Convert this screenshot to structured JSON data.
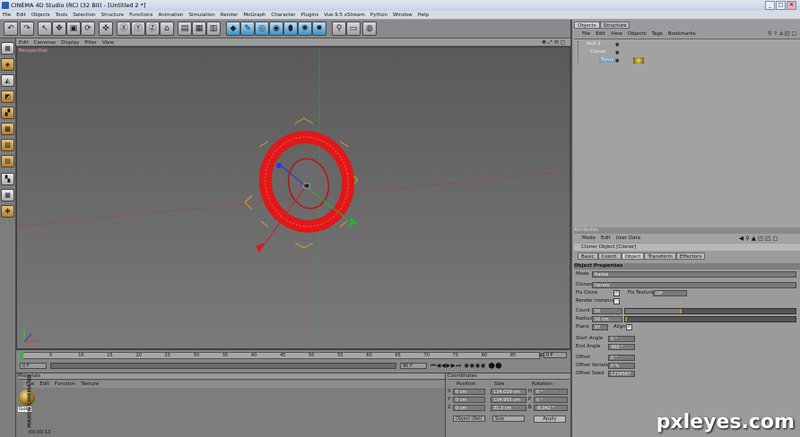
{
  "window": {
    "title": "CINEMA 4D Studio (RC) (32 Bit) - [Untitled 2 *]",
    "min": "_",
    "max": "□",
    "close": "✕"
  },
  "menubar": [
    "File",
    "Edit",
    "Objects",
    "Tools",
    "Selection",
    "Structure",
    "Functions",
    "Animation",
    "Simulation",
    "Render",
    "MoGraph",
    "Character",
    "Plugins",
    "Vue 9.5 xStream",
    "Python",
    "Window",
    "Help"
  ],
  "viewport": {
    "menu": [
      "Edit",
      "Cameras",
      "Display",
      "Filter",
      "View"
    ],
    "label": "Perspective"
  },
  "timeline": {
    "ticks": [
      "0",
      "5",
      "10",
      "15",
      "20",
      "25",
      "30",
      "35",
      "40",
      "45",
      "50",
      "55",
      "60",
      "65",
      "70",
      "75",
      "80",
      "85",
      "90"
    ],
    "start_field": "0 F",
    "end_field": "90 F",
    "current_frame": "0 F",
    "end_frame_field": "90 F"
  },
  "materials": {
    "panel_title": "Materials",
    "menu": [
      "File",
      "Edit",
      "Function",
      "Texture"
    ],
    "material_name": "Gold",
    "status_time": "00:00:13",
    "brand": "MAXON CINEMA 4D"
  },
  "coordinates": {
    "panel_title": "Coordinates",
    "headers": [
      "Position",
      "Size",
      "Rotation"
    ],
    "rows": [
      {
        "axis": "X",
        "pos": "0 cm",
        "size": "134.029 cm",
        "rot_label": "H",
        "rot": "0 °"
      },
      {
        "axis": "Y",
        "pos": "0 cm",
        "size": "134.955 cm",
        "rot_label": "P",
        "rot": "0 °"
      },
      {
        "axis": "Z",
        "pos": "0 cm",
        "size": "31.3 cm",
        "rot_label": "B",
        "rot": "-8.042 °"
      }
    ],
    "mode_select": "Object (Rel)",
    "size_select": "Size",
    "apply": "Apply"
  },
  "objects": {
    "tabs": [
      "Objects",
      "Structure"
    ],
    "menu": [
      "File",
      "Edit",
      "View",
      "Objects",
      "Tags",
      "Bookmarks"
    ],
    "items": [
      {
        "name": "Null.1"
      },
      {
        "name": "Cloner"
      },
      {
        "name": "Torus"
      }
    ]
  },
  "attributes": {
    "panel_title": "Attributes",
    "menu": [
      "Mode",
      "Edit",
      "User Data"
    ],
    "object_title": "Cloner Object [Cloner]",
    "tabs": [
      "Basic",
      "Coord.",
      "Object",
      "Transform",
      "Effectors"
    ],
    "active_tab": "Object",
    "section": "Object Properties",
    "mode_label": "Mode",
    "mode_value": "Radial",
    "clones_label": "Clones",
    "clones_value": "Iterate",
    "fix_clone": "Fix Clone",
    "fix_texture": "Fix Texture",
    "fix_texture_value": "Off",
    "render_instances": "Render Instances",
    "count_label": "Count",
    "count_value": "50",
    "count_fill": 0.33,
    "radius_label": "Radius",
    "radius_value": "50 cm",
    "radius_fill": 0.0,
    "plane_label": "Plane",
    "plane_value": "XY",
    "align_label": "Align",
    "start_angle_label": "Start Angle",
    "start_angle_value": "0 °",
    "end_angle_label": "End Angle",
    "end_angle_value": "360 °",
    "offset_label": "Offset",
    "offset_value": "0 °",
    "offset_variation_label": "Offset Variation",
    "offset_variation_value": "0 %",
    "offset_seed_label": "Offset Seed",
    "offset_seed_value": "1234567"
  },
  "watermark": "pxleyes.com"
}
